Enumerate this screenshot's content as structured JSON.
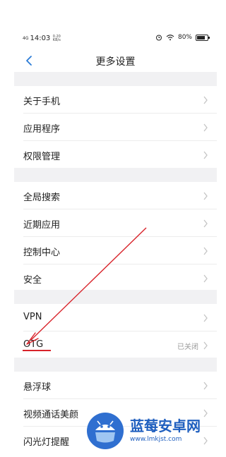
{
  "status_bar": {
    "network": "4G",
    "time": "14:03",
    "speed": "0.20 KB/s",
    "battery": "80%",
    "battery_level": 0.8
  },
  "header": {
    "title": "更多设置"
  },
  "groups": [
    {
      "items": [
        {
          "label": "关于手机"
        },
        {
          "label": "应用程序"
        },
        {
          "label": "权限管理"
        }
      ]
    },
    {
      "items": [
        {
          "label": "全局搜索"
        },
        {
          "label": "近期应用"
        },
        {
          "label": "控制中心"
        },
        {
          "label": "安全"
        }
      ]
    },
    {
      "items": [
        {
          "label": "VPN"
        },
        {
          "label": "OTG",
          "value": "已关闭"
        }
      ]
    },
    {
      "items": [
        {
          "label": "悬浮球"
        },
        {
          "label": "视频通话美颜"
        },
        {
          "label": "闪光灯提醒"
        }
      ]
    }
  ],
  "watermark": {
    "title": "蓝莓安卓网",
    "url": "www.lmkjst.com"
  },
  "colors": {
    "accent": "#2b7bd6",
    "annotation": "#d8232a",
    "divider": "#f1f1f3"
  }
}
